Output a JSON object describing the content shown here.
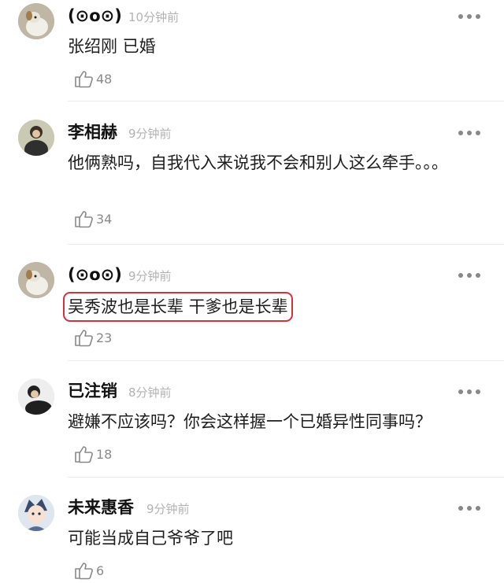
{
  "comments": [
    {
      "author": "(⊙o⊙)",
      "time": "10分钟前",
      "text": "张绍刚 已婚",
      "likes": "48",
      "avatar_icon": "dog-avatar-icon"
    },
    {
      "author": "李相赫",
      "time": "9分钟前",
      "text": "他俩熟吗，自我代入来说我不会和别人这么牵手。。。",
      "likes": "34",
      "avatar_icon": "person-avatar-icon"
    },
    {
      "author": "(⊙o⊙)",
      "time": "9分钟前",
      "text": "吴秀波也是长辈 干爹也是长辈",
      "likes": "23",
      "avatar_icon": "dog-avatar-icon",
      "highlighted": true,
      "highlight_color": "#d0333b"
    },
    {
      "author": "已注销",
      "time": "8分钟前",
      "text": "避嫌不应该吗？你会这样握一个已婚异性同事吗？",
      "likes": "18",
      "avatar_icon": "person-avatar-icon"
    },
    {
      "author": "未来惠香",
      "time": "9分钟前",
      "text": "可能当成自己爷爷了吧",
      "likes": "6",
      "avatar_icon": "anime-avatar-icon"
    }
  ]
}
